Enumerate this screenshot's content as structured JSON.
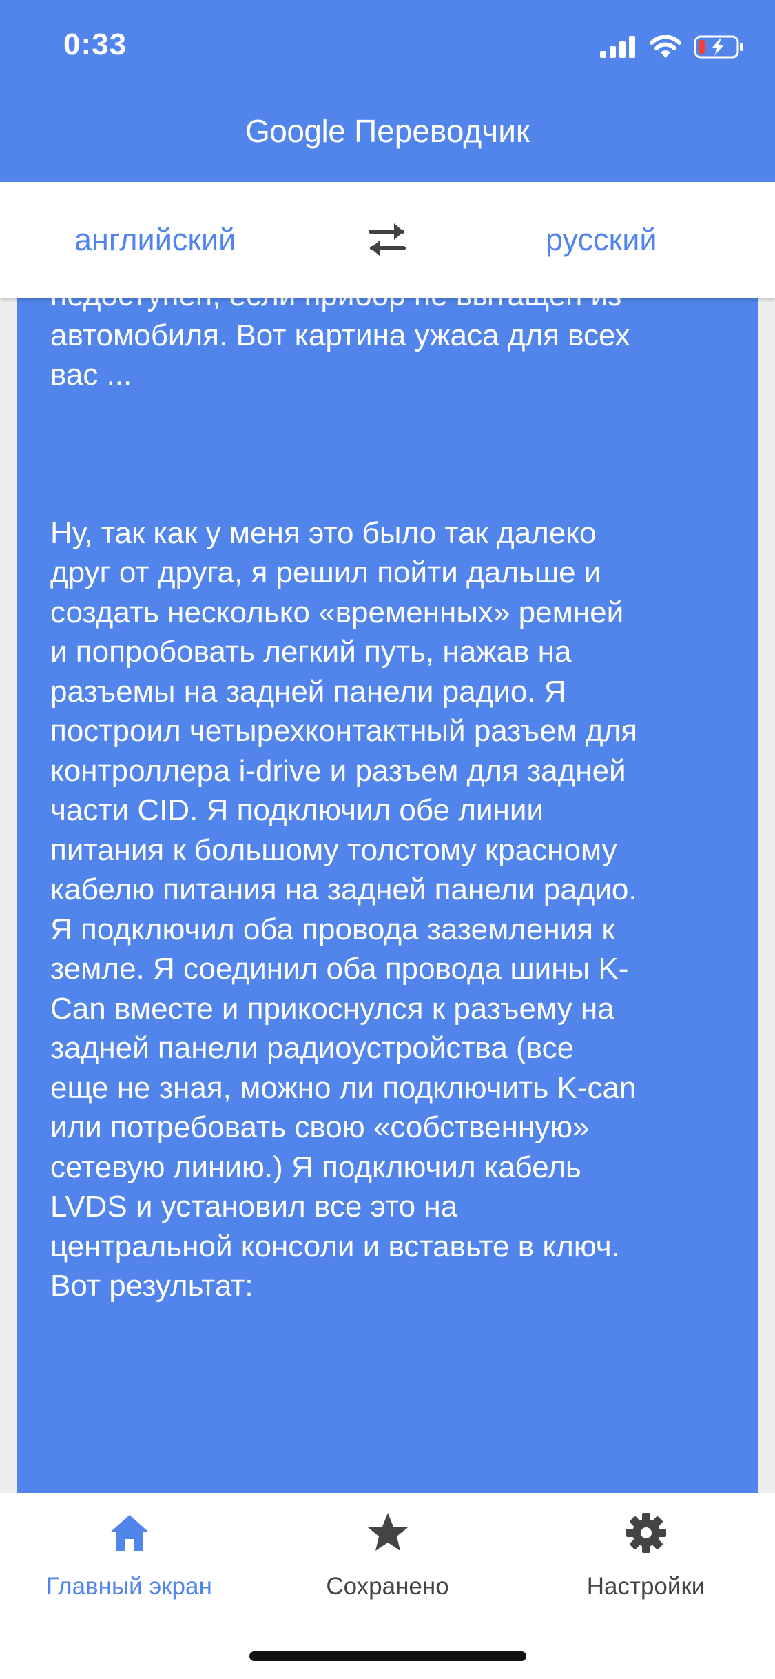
{
  "status_bar": {
    "time": "0:33"
  },
  "header": {
    "brand": "Google",
    "product": "Переводчик"
  },
  "languages": {
    "source": "английский",
    "target": "русский",
    "swap_icon": "swap-arrows-icon"
  },
  "translation": {
    "paragraph_1": "недоступен, если прибор не вытащен из\nавтомобиля. Вот картина ужаса для всех\nвас  ...",
    "paragraph_2": " Ну, так как у меня это было так далеко\nдруг от друга, я решил пойти дальше и\nсоздать несколько «временных» ремней\nи попробовать легкий путь, нажав на\nразъемы на задней панели радио.  Я\nпостроил четырехконтактный разъем для\nконтроллера i-drive и разъем для задней\nчасти CID.  Я подключил обе линии\nпитания к большому толстому красному\nкабелю питания на задней панели радио.\nЯ подключил оба провода заземления к\nземле.  Я соединил оба провода шины K-\nCan вместе и прикоснулся к разъему на\nзадней панели радиоустройства (все\nеще не зная, можно ли подключить K-can\nили потребовать свою «собственную»\nсетевую линию.) Я подключил кабель\nLVDS и установил  все это на\nцентральной консоли и вставьте в ключ.\nВот результат:"
  },
  "bottom_nav": {
    "items": [
      {
        "label": "Главный экран",
        "icon": "home-icon",
        "active": true
      },
      {
        "label": "Сохранено",
        "icon": "star-icon",
        "active": false
      },
      {
        "label": "Настройки",
        "icon": "gear-icon",
        "active": false
      }
    ]
  },
  "colors": {
    "accent": "#5185ec",
    "text_on_accent": "#ffffff",
    "inactive_icon": "#444444",
    "battery_low": "#ff3b30"
  }
}
